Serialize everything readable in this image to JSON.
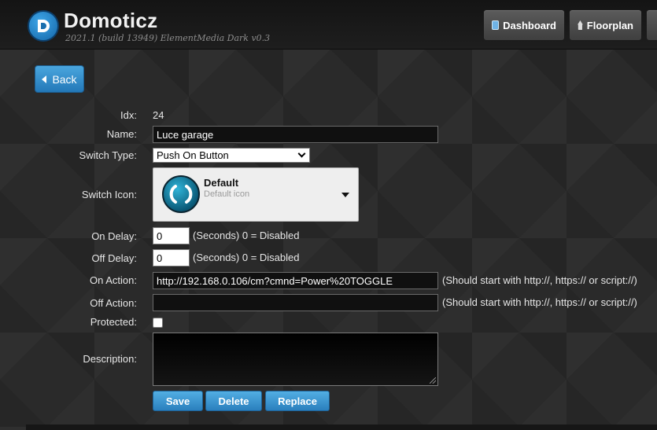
{
  "header": {
    "brand_title": "Domoticz",
    "brand_subtitle": "2021.1 (build 13949) ElementMedia Dark v0.3",
    "nav": [
      {
        "label": "Dashboard",
        "icon": "dashboard-icon"
      },
      {
        "label": "Floorplan",
        "icon": "floorplan-icon"
      }
    ]
  },
  "back_button": {
    "label": "Back"
  },
  "form": {
    "idx": {
      "label": "Idx:",
      "value": "24"
    },
    "name": {
      "label": "Name:",
      "value": "Luce garage"
    },
    "switch_type": {
      "label": "Switch Type:",
      "selected": "Push On Button"
    },
    "switch_icon": {
      "label": "Switch Icon:",
      "title": "Default",
      "subtitle": "Default icon"
    },
    "on_delay": {
      "label": "On Delay:",
      "value": "0",
      "hint": "(Seconds) 0 = Disabled"
    },
    "off_delay": {
      "label": "Off Delay:",
      "value": "0",
      "hint": "(Seconds) 0 = Disabled"
    },
    "on_action": {
      "label": "On Action:",
      "value": "http://192.168.0.106/cm?cmnd=Power%20TOGGLE",
      "hint": "(Should start with http://, https:// or script://)"
    },
    "off_action": {
      "label": "Off Action:",
      "value": "",
      "hint": "(Should start with http://, https:// or script://)"
    },
    "protected": {
      "label": "Protected:",
      "checked": false
    },
    "description": {
      "label": "Description:",
      "value": ""
    }
  },
  "actions": {
    "save": "Save",
    "delete": "Delete",
    "replace": "Replace"
  },
  "colors": {
    "accent_blue": "#2a7fbd",
    "background": "#2a2a2a",
    "header": "#141414"
  }
}
